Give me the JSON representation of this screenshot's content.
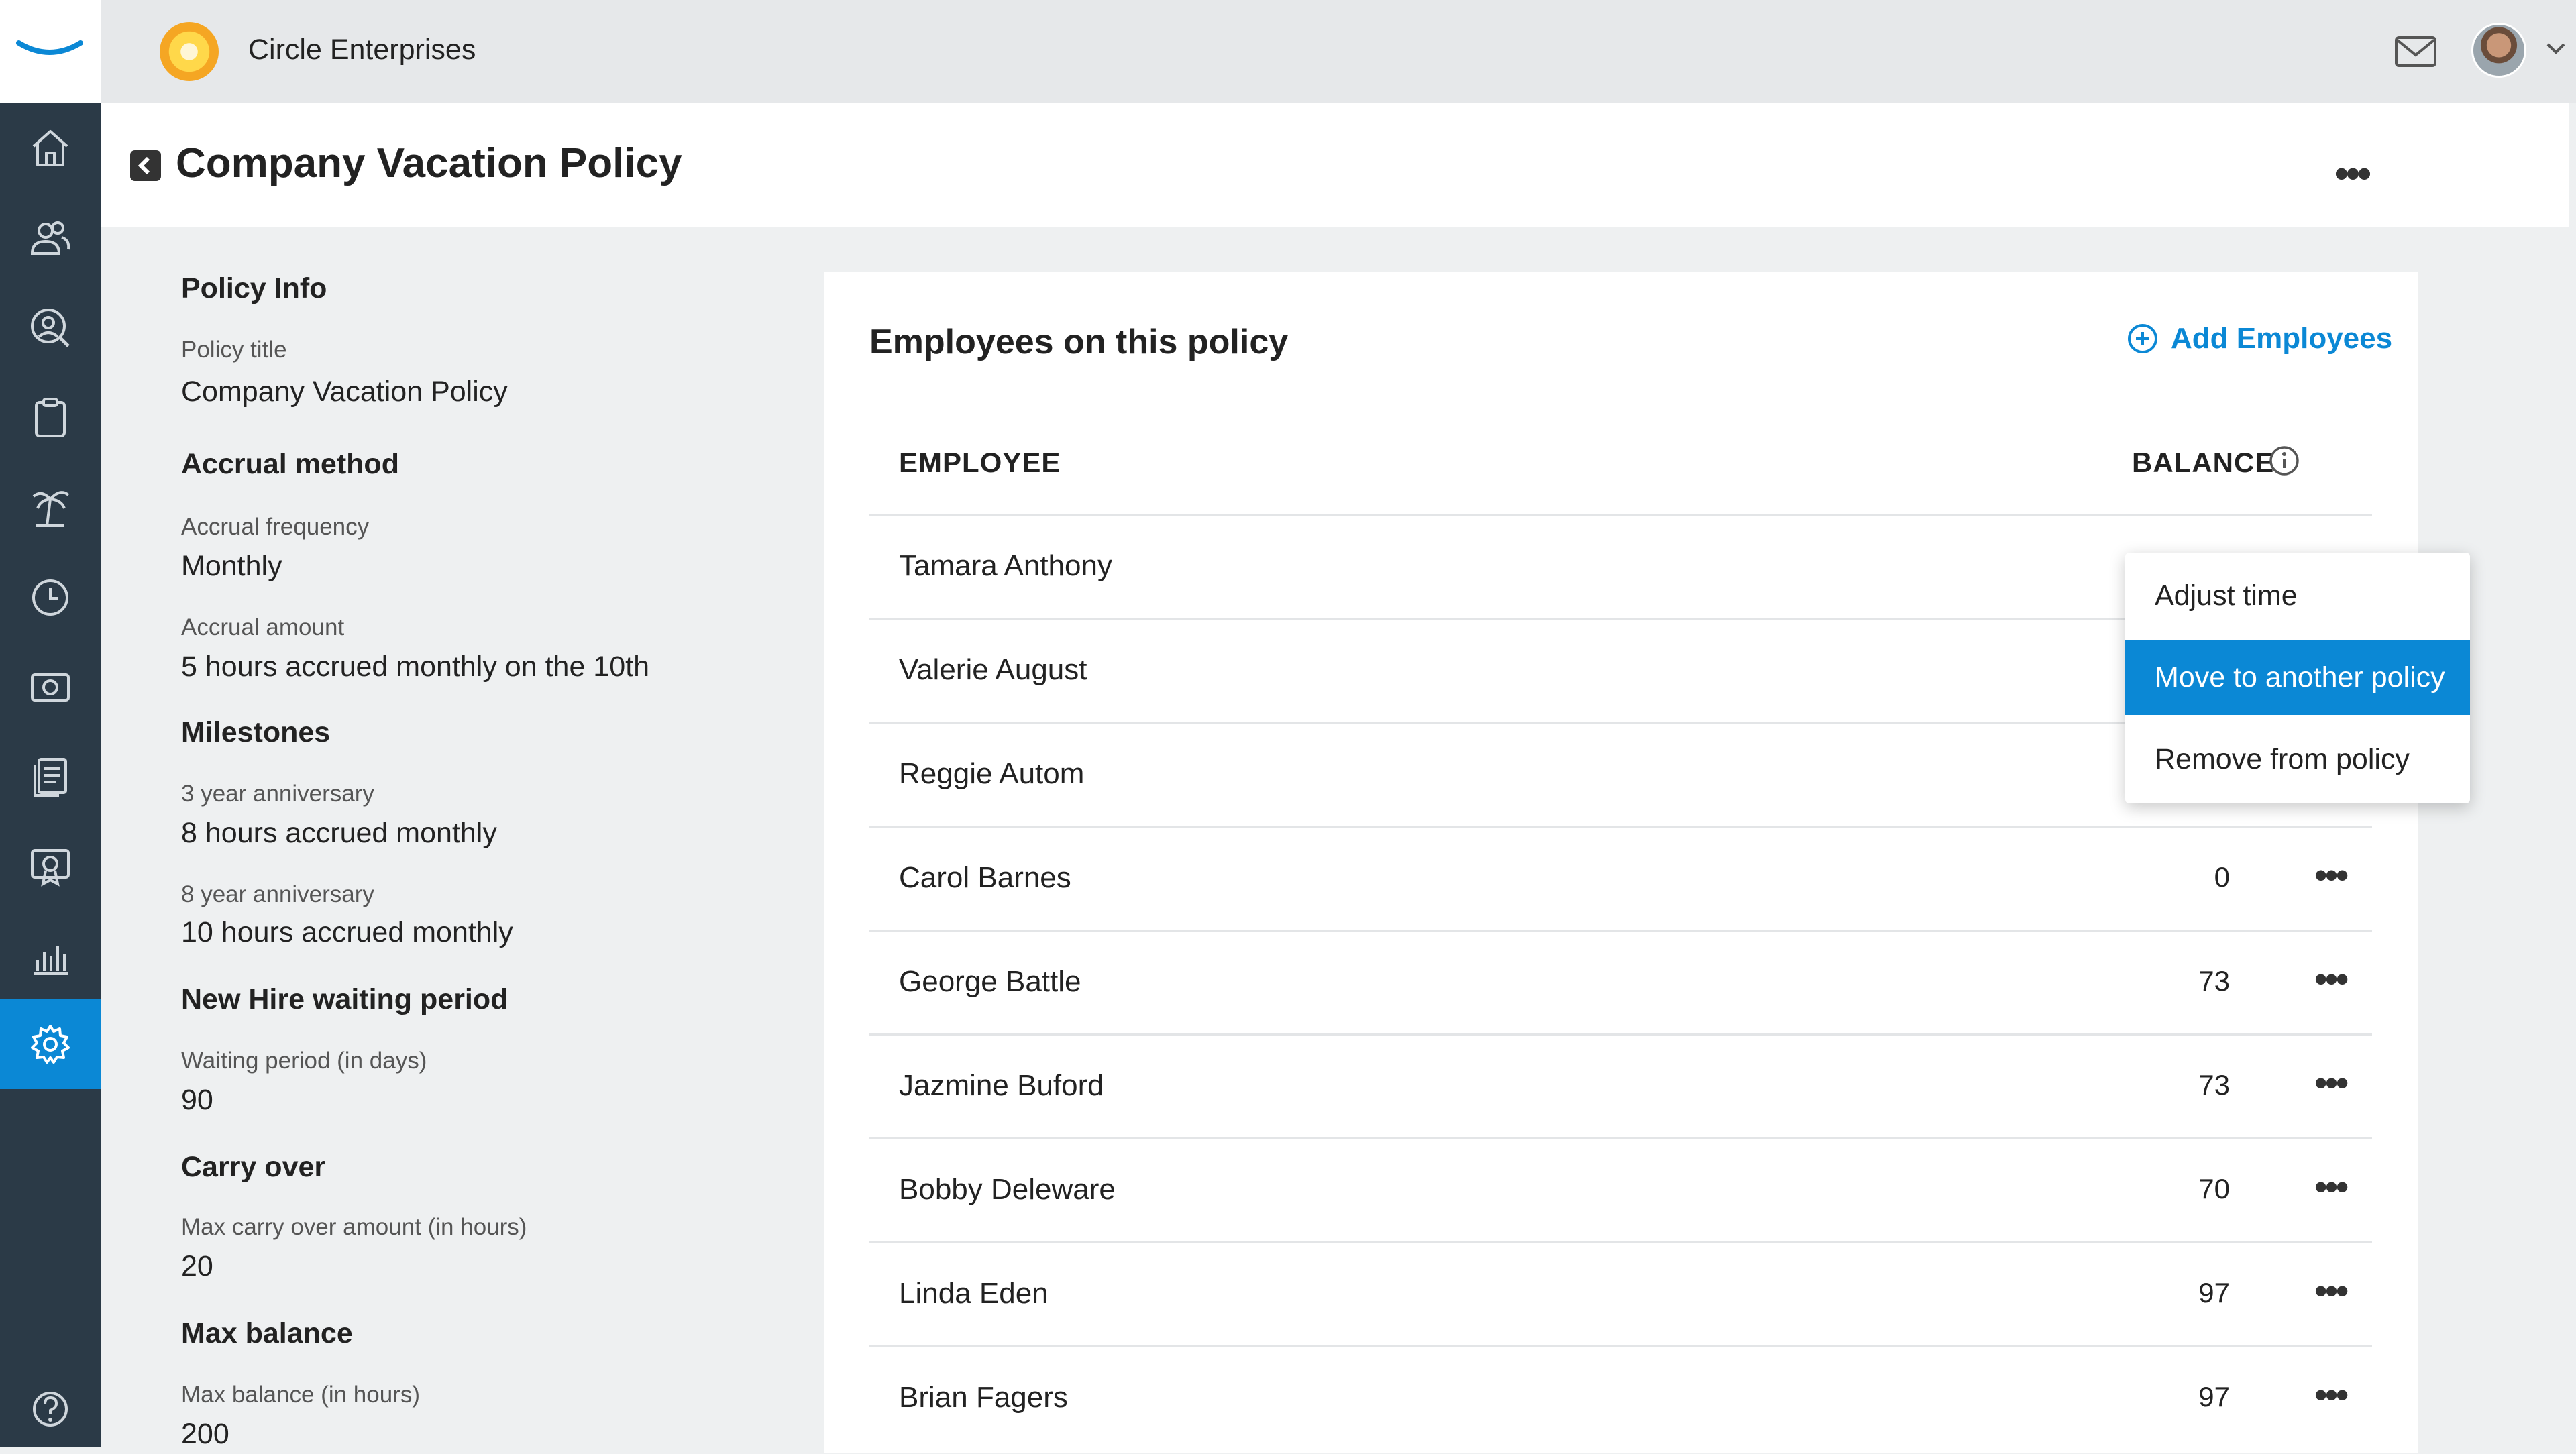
{
  "topbar": {
    "org_name": "Circle Enterprises",
    "mail_icon": "mail-icon",
    "avatar_icon": "user-avatar"
  },
  "nav": {
    "items": [
      {
        "icon": "home-icon"
      },
      {
        "icon": "people-icon"
      },
      {
        "icon": "person-search-icon"
      },
      {
        "icon": "clipboard-icon"
      },
      {
        "icon": "palm-tree-icon"
      },
      {
        "icon": "clock-icon"
      },
      {
        "icon": "money-icon"
      },
      {
        "icon": "documents-icon"
      },
      {
        "icon": "certificate-icon"
      },
      {
        "icon": "bar-chart-icon"
      },
      {
        "icon": "gear-icon",
        "active": true
      },
      {
        "icon": "help-icon"
      }
    ],
    "active_color": "#0b88d5",
    "background": "#2b3a47"
  },
  "page": {
    "title": "Company Vacation Policy"
  },
  "policy_info": {
    "heading": "Policy Info",
    "policy_title_label": "Policy title",
    "policy_title_value": "Company Vacation Policy",
    "accrual_heading": "Accrual method",
    "accrual_frequency_label": "Accrual frequency",
    "accrual_frequency_value": "Monthly",
    "accrual_amount_label": "Accrual amount",
    "accrual_amount_value": "5 hours accrued monthly on the 10th",
    "milestones_heading": "Milestones",
    "milestone_1_label": "3 year anniversary",
    "milestone_1_value": "8 hours accrued monthly",
    "milestone_2_label": "8 year anniversary",
    "milestone_2_value": "10 hours accrued monthly",
    "waiting_heading": "New Hire waiting period",
    "waiting_label": "Waiting period (in days)",
    "waiting_value": "90",
    "carry_heading": "Carry over",
    "carry_label": "Max carry over amount (in hours)",
    "carry_value": "20",
    "max_heading": "Max balance",
    "max_label": "Max balance (in hours)",
    "max_value": "200"
  },
  "employees": {
    "title": "Employees on this policy",
    "add_label": "Add Employees",
    "col_employee": "EMPLOYEE",
    "col_balance": "BALANCE",
    "rows": [
      {
        "name": "Tamara Anthony",
        "balance": ""
      },
      {
        "name": "Valerie August",
        "balance": ""
      },
      {
        "name": "Reggie Autom",
        "balance": ""
      },
      {
        "name": "Carol Barnes",
        "balance": "0"
      },
      {
        "name": "George Battle",
        "balance": "73"
      },
      {
        "name": "Jazmine Buford",
        "balance": "73"
      },
      {
        "name": "Bobby Deleware",
        "balance": "70"
      },
      {
        "name": "Linda Eden",
        "balance": "97"
      },
      {
        "name": "Brian Fagers",
        "balance": "97"
      }
    ]
  },
  "context_menu": {
    "items": [
      "Adjust time",
      "Move to another policy",
      "Remove from policy"
    ],
    "selected_index": 1
  }
}
